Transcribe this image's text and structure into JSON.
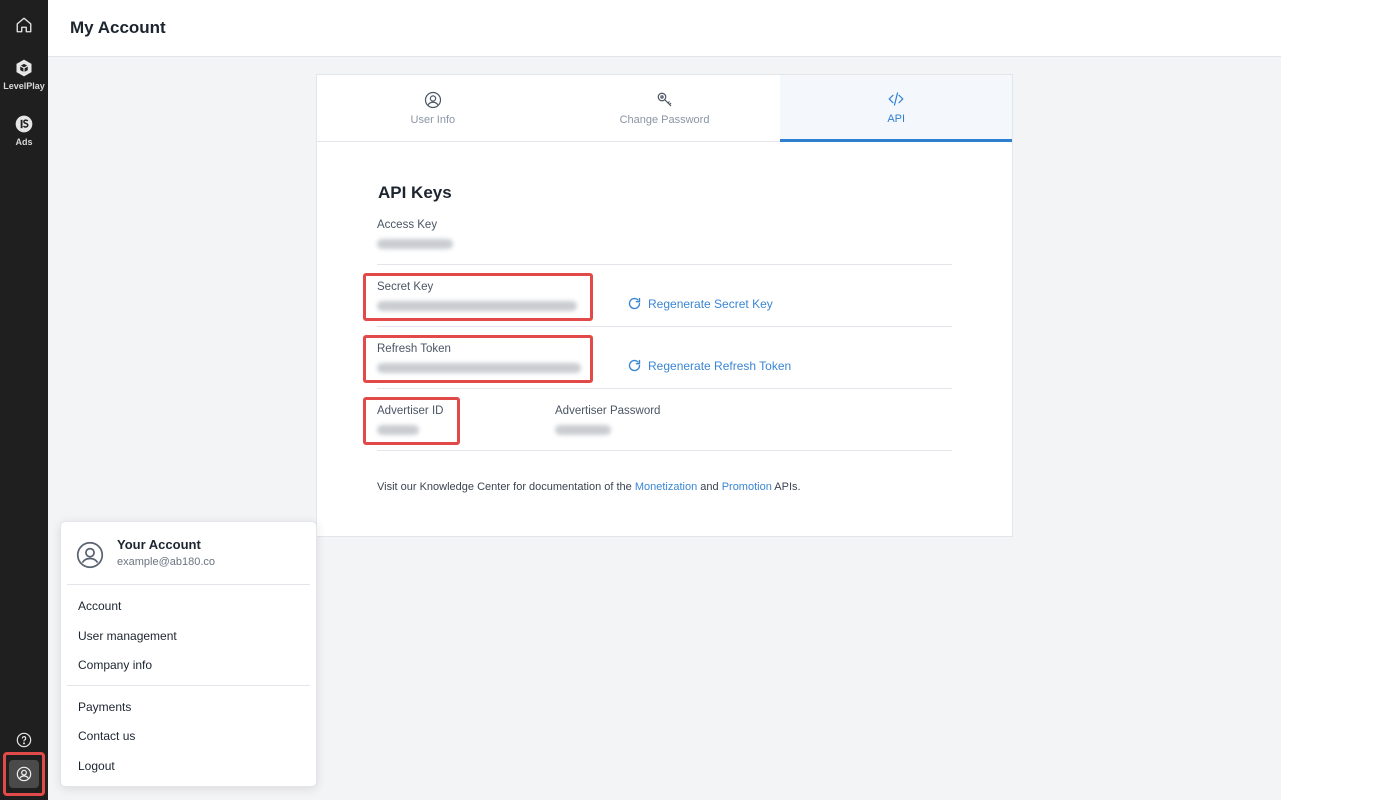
{
  "rail": {
    "levelplay_label": "LevelPlay",
    "ads_label": "Ads"
  },
  "header": {
    "title": "My Account"
  },
  "tabs": [
    {
      "label": "User Info",
      "icon": "user-circle-icon",
      "active": false
    },
    {
      "label": "Change Password",
      "icon": "key-icon",
      "active": false
    },
    {
      "label": "API",
      "icon": "code-icon",
      "active": true
    }
  ],
  "api": {
    "title": "API Keys",
    "access_key_label": "Access Key",
    "secret_key_label": "Secret Key",
    "regenerate_secret": "Regenerate Secret Key",
    "refresh_token_label": "Refresh Token",
    "regenerate_refresh": "Regenerate Refresh Token",
    "advertiser_id_label": "Advertiser ID",
    "advertiser_password_label": "Advertiser Password"
  },
  "note": {
    "prefix": "Visit our Knowledge Center for documentation of the ",
    "link1": "Monetization",
    "middle": " and ",
    "link2": "Promotion",
    "suffix": " APIs."
  },
  "account_menu": {
    "name": "Your Account",
    "email": "example@ab180.co",
    "items_group1": [
      "Account",
      "User management",
      "Company info"
    ],
    "items_group2": [
      "Payments",
      "Contact us",
      "Logout"
    ]
  },
  "colors": {
    "accent": "#2f7fd0",
    "highlight": "#e24a4a",
    "rail_bg": "#1f1f1f"
  }
}
